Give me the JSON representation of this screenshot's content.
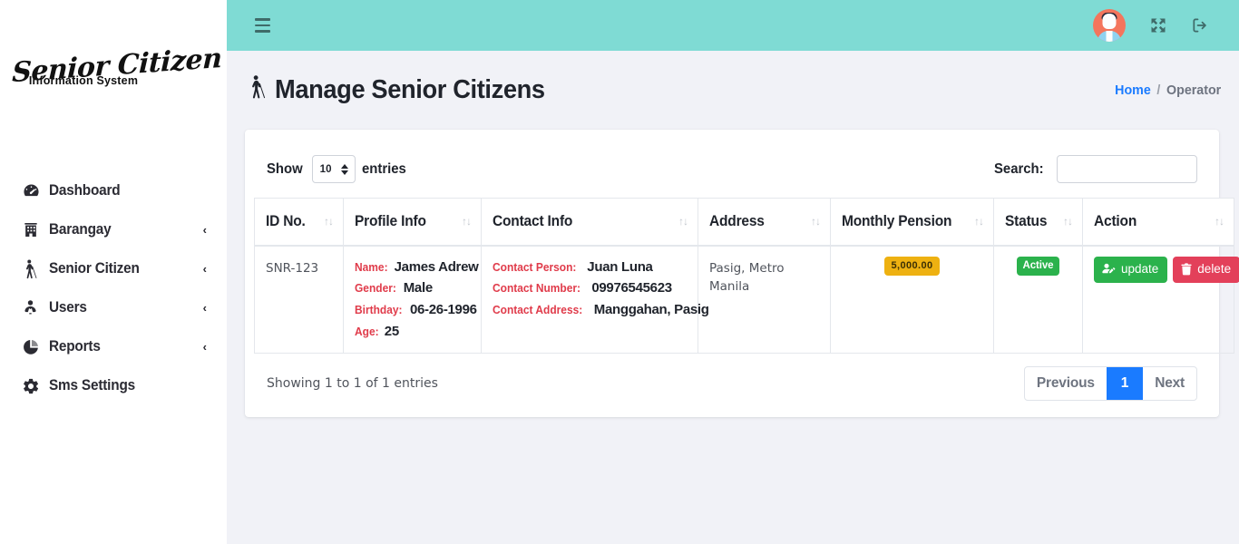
{
  "brand": {
    "script": "Senior Citizen",
    "subtitle": "Information System"
  },
  "sidebar": {
    "items": [
      {
        "label": "Dashboard",
        "icon": "tachometer-icon",
        "chevron": ""
      },
      {
        "label": "Barangay",
        "icon": "building-icon",
        "chevron": "‹"
      },
      {
        "label": "Senior Citizen",
        "icon": "blind-person-icon",
        "chevron": "‹"
      },
      {
        "label": "Users",
        "icon": "user-tie-icon",
        "chevron": "‹"
      },
      {
        "label": "Reports",
        "icon": "pie-chart-icon",
        "chevron": "‹"
      },
      {
        "label": "Sms Settings",
        "icon": "gear-icon",
        "chevron": ""
      }
    ]
  },
  "topbar": {
    "menu_icon": "hamburger-icon",
    "avatar_icon": "user-avatar",
    "fullscreen_icon": "expand-arrows-icon",
    "logout_icon": "sign-out-icon",
    "bg_color": "#7fdbd4"
  },
  "page": {
    "title": "Manage Senior Citizens",
    "title_icon": "blind-person-icon",
    "breadcrumb": {
      "home": "Home",
      "separator": "/",
      "current": "Operator"
    }
  },
  "datatable": {
    "length_label_before": "Show",
    "length_value": "10",
    "length_label_after": "entries",
    "search_label": "Search:",
    "search_value": "",
    "search_placeholder": "",
    "sort_glyph": "↑↓",
    "columns": [
      "ID No.",
      "Profile Info",
      "Contact Info",
      "Address",
      "Monthly Pension",
      "Status",
      "Action"
    ],
    "row": {
      "id_no": "SNR-123",
      "profile": [
        {
          "key": "Name:",
          "value": "James Adrew"
        },
        {
          "key": "Gender:",
          "value": "Male"
        },
        {
          "key": "Birthday:",
          "value": "06-26-1996"
        },
        {
          "key": "Age:",
          "value": "25"
        }
      ],
      "contact": [
        {
          "key": "Contact Person:",
          "value": "Juan Luna"
        },
        {
          "key": "Contact Number:",
          "value": "09976545623"
        },
        {
          "key": "Contact Address:",
          "value": "Manggahan, Pasig"
        }
      ],
      "address": "Pasig, Metro Manila",
      "monthly_pension": "5,000.00",
      "status": "Active",
      "actions": {
        "update_label": "update",
        "update_icon": "user-edit-icon",
        "delete_label": "delete",
        "delete_icon": "trash-icon"
      }
    },
    "info": "Showing 1 to 1 of 1 entries",
    "pagination": {
      "previous": "Previous",
      "page_1": "1",
      "next": "Next"
    }
  },
  "colors": {
    "accent_teal": "#7fdbd4",
    "link_blue": "#1a7bff",
    "label_red": "#e03b4a",
    "success_green": "#2bb24c",
    "danger_red": "#e3405a",
    "warning_yellow": "#eeb111",
    "page_bg": "#f1f2f7"
  }
}
